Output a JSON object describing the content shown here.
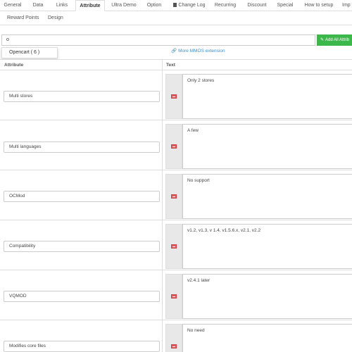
{
  "tabs_row1": [
    "General",
    "Data",
    "Links",
    "Attribute",
    "Ultra Demo",
    "Option",
    "Change Log",
    "Recurring",
    "Discount",
    "Special",
    "How to setup",
    "Imp"
  ],
  "tabs_row2": [
    "Reward Points",
    "Design"
  ],
  "add_input_value": "o",
  "add_button_label": "Add All Attrib",
  "dropdown_option": "Opencart ( 6 )",
  "more_link": "More MMOS extension",
  "table": {
    "col_attribute": "Attribute",
    "col_text": "Text",
    "rows": [
      {
        "attribute": "Multi stores",
        "text": "Only 2 stores"
      },
      {
        "attribute": "Multi languages",
        "text": "A few"
      },
      {
        "attribute": "OCMod",
        "text": "No support"
      },
      {
        "attribute": "Compatibility",
        "text": "v1.2, v1.3, v 1.4, v1.5.6.x, v2.1, v2.2"
      },
      {
        "attribute": "VQMOD",
        "text": "v2.4.1 later"
      },
      {
        "attribute": "Modifies core files",
        "text": "No need"
      }
    ]
  },
  "colors": {
    "add_button": "#3cb84a",
    "link": "#3a8fd0"
  }
}
